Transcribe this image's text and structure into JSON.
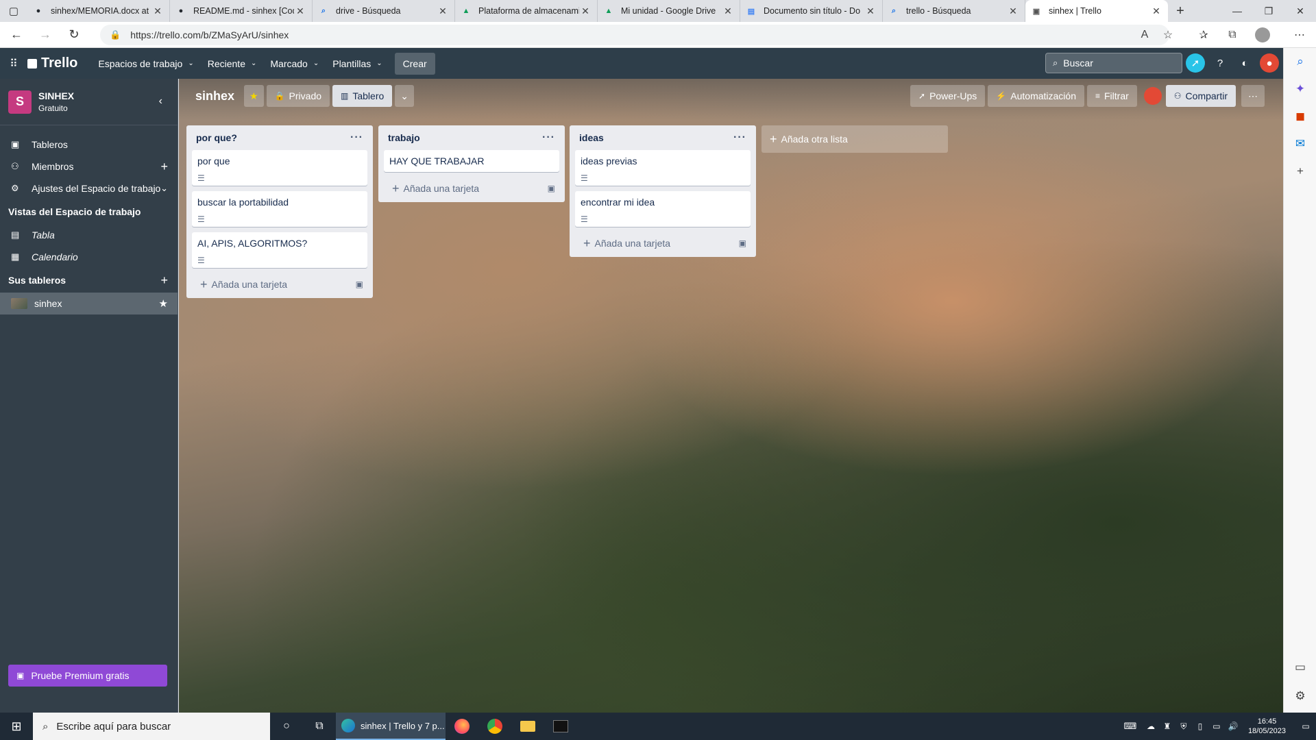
{
  "browser": {
    "tabs": [
      {
        "title": "sinhex/MEMORIA.docx at m",
        "icon": "github-icon",
        "color": "#24292f"
      },
      {
        "title": "README.md - sinhex [Cod",
        "icon": "github-icon",
        "color": "#24292f"
      },
      {
        "title": "drive - Búsqueda",
        "icon": "search-icon",
        "color": "#1a73e8"
      },
      {
        "title": "Plataforma de almacenami",
        "icon": "google-drive-icon",
        "color": "#0f9d58"
      },
      {
        "title": "Mi unidad - Google Drive",
        "icon": "google-drive-icon",
        "color": "#0f9d58"
      },
      {
        "title": "Documento sin título - Do",
        "icon": "google-docs-icon",
        "color": "#4285f4"
      },
      {
        "title": "trello - Búsqueda",
        "icon": "search-icon",
        "color": "#1a73e8"
      },
      {
        "title": "sinhex | Trello",
        "icon": "trello-icon",
        "color": "#555555",
        "active": true
      }
    ],
    "url": "https://trello.com/b/ZMaSyArU/sinhex"
  },
  "trello_header": {
    "logo": "Trello",
    "menus": [
      "Espacios de trabajo",
      "Reciente",
      "Marcado",
      "Plantillas"
    ],
    "create": "Crear",
    "search_placeholder": "Buscar"
  },
  "workspace": {
    "initial": "S",
    "name": "SINHEX",
    "plan": "Gratuito",
    "nav": [
      "Tableros",
      "Miembros",
      "Ajustes del Espacio de trabajo"
    ],
    "views_title": "Vistas del Espacio de trabajo",
    "views": [
      "Tabla",
      "Calendario"
    ],
    "boards_title": "Sus tableros",
    "boards": [
      "sinhex"
    ],
    "premium": "Pruebe Premium gratis"
  },
  "board": {
    "name": "sinhex",
    "visibility": "Privado",
    "view": "Tablero",
    "right_buttons": [
      "Power-Ups",
      "Automatización",
      "Filtrar"
    ],
    "share": "Compartir",
    "add_card": "Añada una tarjeta",
    "add_list": "Añada otra lista",
    "lists": [
      {
        "title": "por que?",
        "cards": [
          {
            "title": "por que",
            "has_desc": true
          },
          {
            "title": "buscar la portabilidad",
            "has_desc": true
          },
          {
            "title": "AI, APIS, ALGORITMOS?",
            "has_desc": true
          }
        ]
      },
      {
        "title": "trabajo",
        "cards": [
          {
            "title": "HAY QUE TRABAJAR",
            "has_desc": false
          }
        ]
      },
      {
        "title": "ideas",
        "cards": [
          {
            "title": "ideas previas",
            "has_desc": true
          },
          {
            "title": "encontrar mi idea",
            "has_desc": true
          }
        ]
      }
    ]
  },
  "taskbar": {
    "search_placeholder": "Escribe aquí para buscar",
    "active_window": "sinhex | Trello y 7 p...",
    "time": "16:45",
    "date": "18/05/2023"
  },
  "colors": {
    "header_bg": "#2e3e4a",
    "sidebar_bg": "#333f49",
    "workspace_avatar": "#c53a80",
    "premium": "#8f49d6",
    "list_bg": "#ebecf0",
    "star": "#f2d600"
  }
}
